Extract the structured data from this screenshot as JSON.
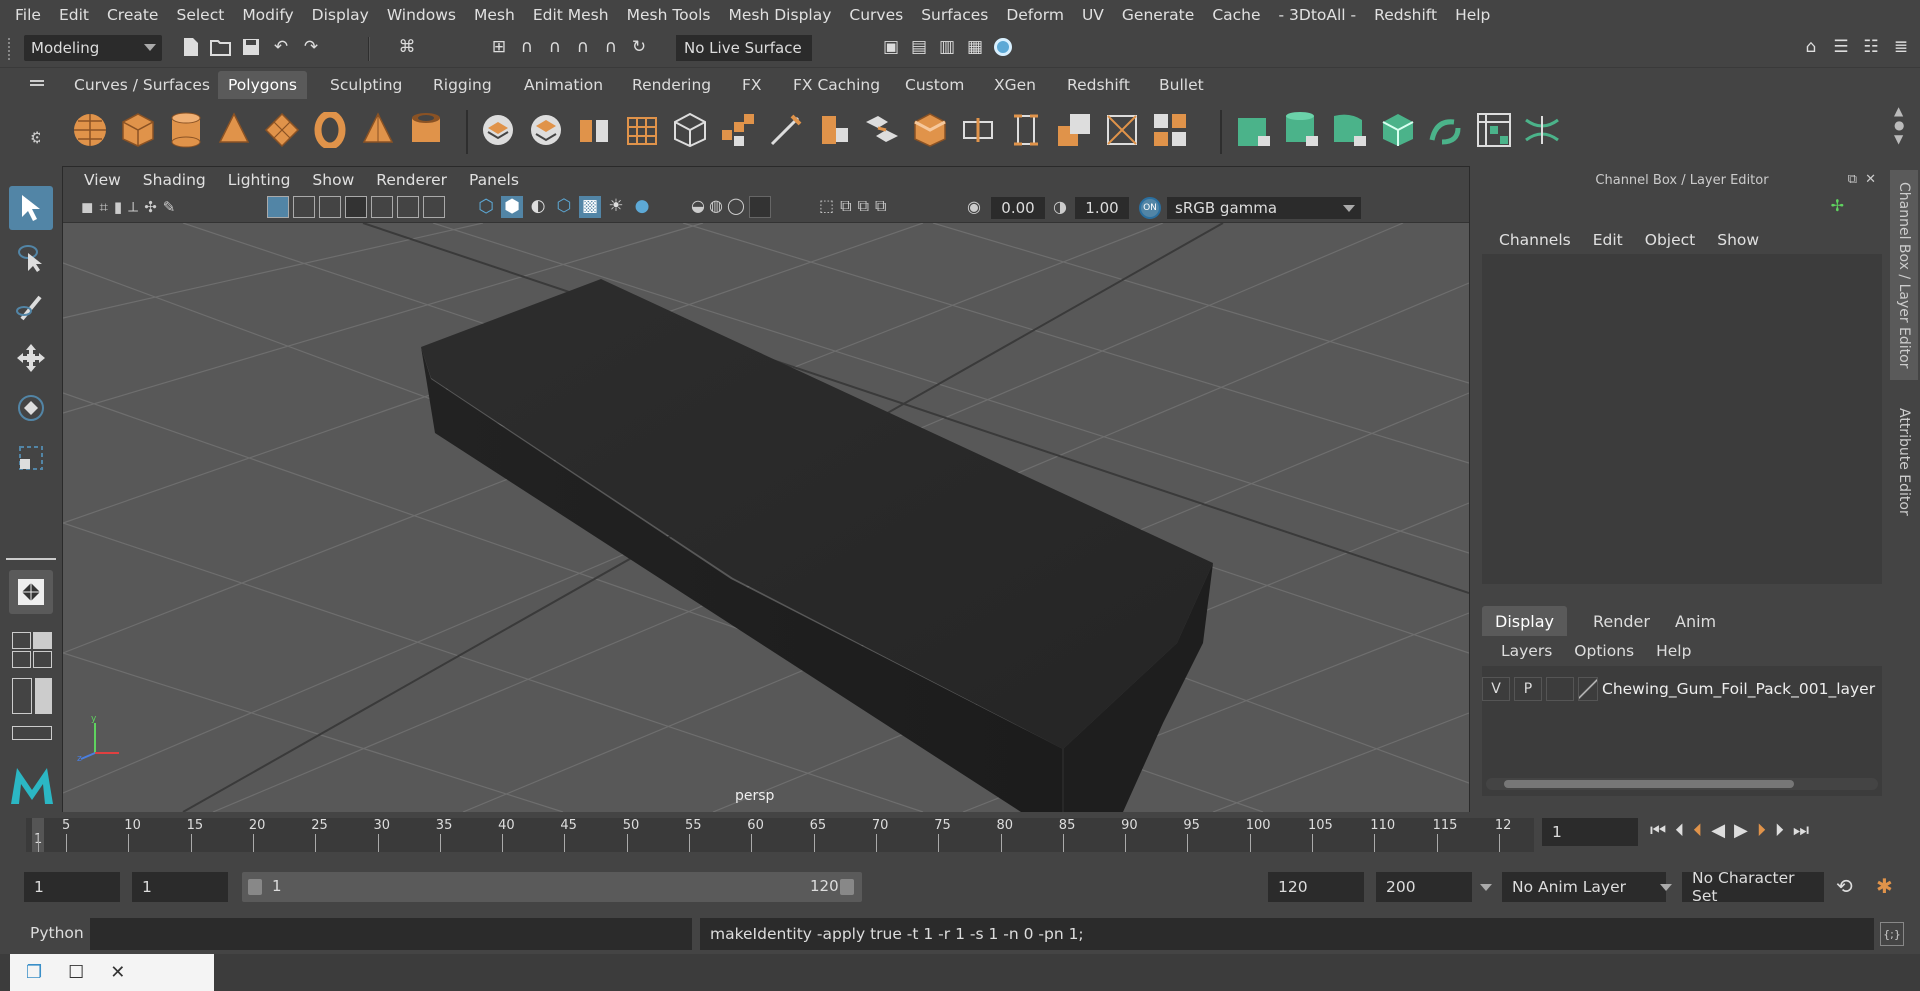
{
  "menubar": {
    "items": [
      "File",
      "Edit",
      "Create",
      "Select",
      "Modify",
      "Display",
      "Windows",
      "Mesh",
      "Edit Mesh",
      "Mesh Tools",
      "Mesh Display",
      "Curves",
      "Surfaces",
      "Deform",
      "UV",
      "Generate",
      "Cache",
      "- 3DtoAll -",
      "Redshift",
      "Help"
    ]
  },
  "statusline": {
    "mode": "Modeling",
    "live_surface": "No Live Surface"
  },
  "shelf": {
    "tabs": [
      "Curves / Surfaces",
      "Polygons",
      "Sculpting",
      "Rigging",
      "Animation",
      "Rendering",
      "FX",
      "FX Caching",
      "Custom",
      "XGen",
      "Redshift",
      "Bullet"
    ],
    "active_tab": "Polygons"
  },
  "viewport": {
    "menu": [
      "View",
      "Shading",
      "Lighting",
      "Show",
      "Renderer",
      "Panels"
    ],
    "exposure": "0.00",
    "gamma": "1.00",
    "color_space": "sRGB gamma",
    "camera_label": "persp"
  },
  "channel_box": {
    "title": "Channel Box / Layer Editor",
    "menu": [
      "Channels",
      "Edit",
      "Object",
      "Show"
    ],
    "layer_tabs": [
      "Display",
      "Render",
      "Anim"
    ],
    "layer_menu": [
      "Layers",
      "Options",
      "Help"
    ],
    "layer": {
      "v": "V",
      "p": "P",
      "name": "Chewing_Gum_Foil_Pack_001_layer"
    },
    "side_tabs": [
      "Channel Box / Layer Editor",
      "Attribute Editor"
    ]
  },
  "timeline": {
    "ticks": [
      "1",
      "5",
      "10",
      "15",
      "20",
      "25",
      "30",
      "35",
      "40",
      "45",
      "50",
      "55",
      "60",
      "65",
      "70",
      "75",
      "80",
      "85",
      "90",
      "95",
      "100",
      "105",
      "110",
      "115",
      "12"
    ],
    "current_frame": "1"
  },
  "range": {
    "start": "1",
    "playback_start": "1",
    "slider_start": "1",
    "slider_end": "120",
    "playback_end": "120",
    "end": "200",
    "anim_layer": "No Anim Layer",
    "character_set": "No Character Set"
  },
  "command": {
    "language": "Python",
    "output": "makeIdentity -apply true -t 1 -r 1 -s 1 -n 0 -pn 1;"
  },
  "colors": {
    "accent": "#5285a6",
    "shelf_orange": "#e0934a",
    "shelf_green": "#4bb38a",
    "object": "#2a2a2a"
  }
}
